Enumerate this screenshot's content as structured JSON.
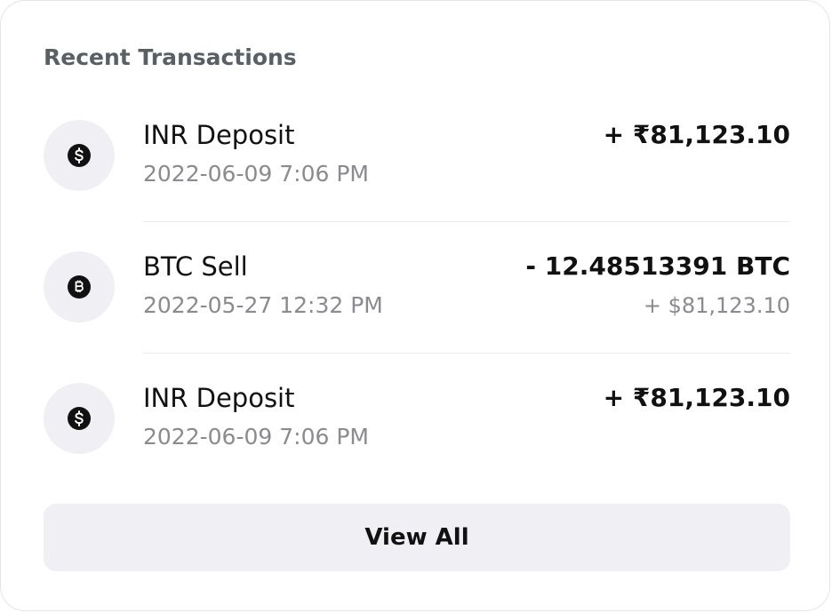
{
  "card": {
    "title": "Recent Transactions"
  },
  "transactions": [
    {
      "icon": "dollar-coin-icon",
      "name": "INR Deposit",
      "time": "2022-06-09 7:06 PM",
      "amount": "+ ₹81,123.10",
      "sub_amount": ""
    },
    {
      "icon": "bitcoin-coin-icon",
      "name": "BTC Sell",
      "time": "2022-05-27 12:32 PM",
      "amount": "- 12.48513391 BTC",
      "sub_amount": "+ $81,123.10"
    },
    {
      "icon": "dollar-coin-icon",
      "name": "INR Deposit",
      "time": "2022-06-09 7:06 PM",
      "amount": "+ ₹81,123.10",
      "sub_amount": ""
    }
  ],
  "actions": {
    "view_all_label": "View All"
  },
  "colors": {
    "title": "#5a5f66",
    "muted_text": "#8a8a90",
    "icon_bg": "#f0f0f4",
    "button_bg": "#efeff4",
    "divider": "#ebebef"
  }
}
